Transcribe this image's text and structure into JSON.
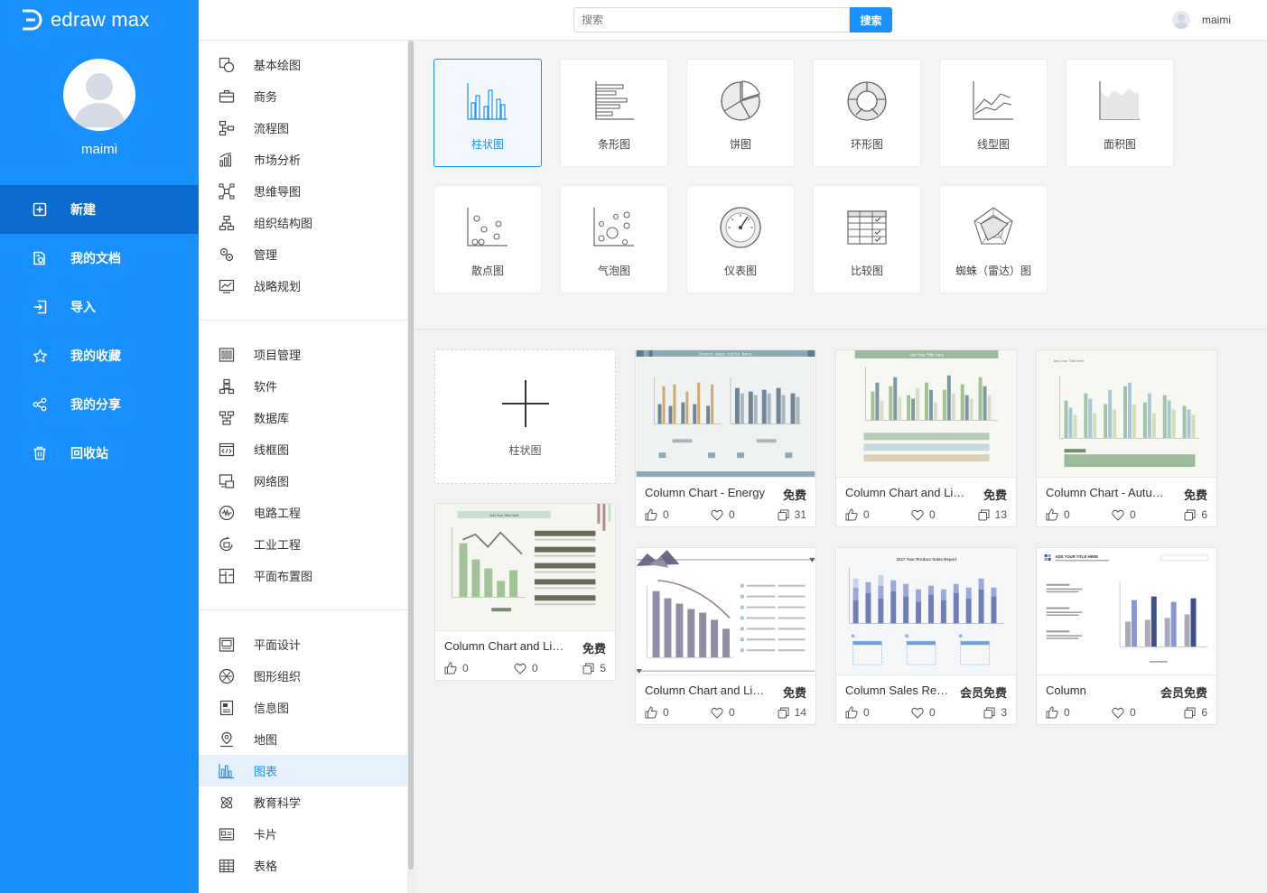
{
  "app": {
    "logo_text": "edraw max",
    "username": "maimi"
  },
  "sidebar": {
    "items": [
      {
        "label": "新建",
        "icon": "new-file-icon",
        "active": true
      },
      {
        "label": "我的文档",
        "icon": "documents-icon"
      },
      {
        "label": "导入",
        "icon": "import-icon"
      },
      {
        "label": "我的收藏",
        "icon": "star-icon"
      },
      {
        "label": "我的分享",
        "icon": "share-icon"
      },
      {
        "label": "回收站",
        "icon": "trash-icon"
      }
    ]
  },
  "topbar": {
    "search_placeholder": "搜索",
    "search_button": "搜索",
    "username": "maimi"
  },
  "categories": {
    "group1": [
      "基本绘图",
      "商务",
      "流程图",
      "市场分析",
      "思维导图",
      "组织结构图",
      "管理",
      "战略规划"
    ],
    "group2": [
      "项目管理",
      "软件",
      "数据库",
      "线框图",
      "网络图",
      "电路工程",
      "工业工程",
      "平面布置图"
    ],
    "group3": [
      "平面设计",
      "图形组织",
      "信息图",
      "地图",
      "图表",
      "教育科学",
      "卡片",
      "表格"
    ],
    "active": "图表"
  },
  "chart_types": [
    "柱状图",
    "条形图",
    "饼图",
    "环形图",
    "线型图",
    "面积图",
    "散点图",
    "气泡图",
    "仪表图",
    "比较图",
    "蜘蛛（雷达）图"
  ],
  "selected_type": "柱状图",
  "new_card": {
    "label": "柱状图"
  },
  "templates": [
    {
      "title": "Column Chart - Energy",
      "badge": "免费",
      "likes": "0",
      "favs": "0",
      "copies": "31",
      "thumb_title": "Insert main title here"
    },
    {
      "title": "Column Chart and List...",
      "badge": "免费",
      "likes": "0",
      "favs": "0",
      "copies": "13",
      "thumb_title": "Add Your Title Here"
    },
    {
      "title": "Column Chart - Autumn...",
      "badge": "免费",
      "likes": "0",
      "favs": "0",
      "copies": "6",
      "thumb_title": "Add Your Title Here"
    },
    {
      "title": "Column Chart and List...",
      "badge": "免费",
      "likes": "0",
      "favs": "0",
      "copies": "5",
      "thumb_title": "Add Your Title Here"
    },
    {
      "title": "Column Chart and List...",
      "badge": "免费",
      "likes": "0",
      "favs": "0",
      "copies": "14",
      "thumb_title": ""
    },
    {
      "title": "Column Sales Report",
      "badge": "会员免费",
      "likes": "0",
      "favs": "0",
      "copies": "3",
      "thumb_title": "2017 Year Product Sales Report"
    },
    {
      "title": "Column",
      "badge": "会员免费",
      "likes": "0",
      "favs": "0",
      "copies": "6",
      "thumb_title": "ADD YOUR TITLE HERE"
    }
  ]
}
